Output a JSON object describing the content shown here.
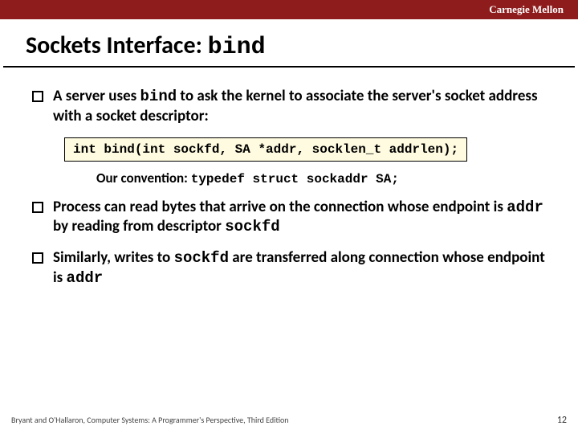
{
  "header": {
    "org": "Carnegie Mellon"
  },
  "title": {
    "prefix": "Sockets Interface: ",
    "code": "bind"
  },
  "bullets": [
    {
      "parts": [
        {
          "t": "A server uses "
        },
        {
          "t": "bind",
          "mono": true
        },
        {
          "t": " to ask the kernel to associate the server's socket address with a socket descriptor:"
        }
      ]
    },
    {
      "parts": [
        {
          "t": "Process can read bytes that arrive on the connection whose endpoint is "
        },
        {
          "t": "addr",
          "mono": true
        },
        {
          "t": "  by reading from descriptor "
        },
        {
          "t": "sockfd",
          "mono": true
        }
      ]
    },
    {
      "parts": [
        {
          "t": "Similarly, writes to "
        },
        {
          "t": "sockfd",
          "mono": true
        },
        {
          "t": " are transferred along connection whose endpoint is "
        },
        {
          "t": "addr",
          "mono": true
        }
      ]
    }
  ],
  "codebox": "int bind(int sockfd, SA *addr, socklen_t addrlen);",
  "convention": {
    "label": "Our convention: ",
    "code": "typedef struct sockaddr SA;"
  },
  "footer": {
    "credit": "Bryant and O'Hallaron, Computer Systems: A Programmer's Perspective, Third Edition",
    "page": "12"
  }
}
